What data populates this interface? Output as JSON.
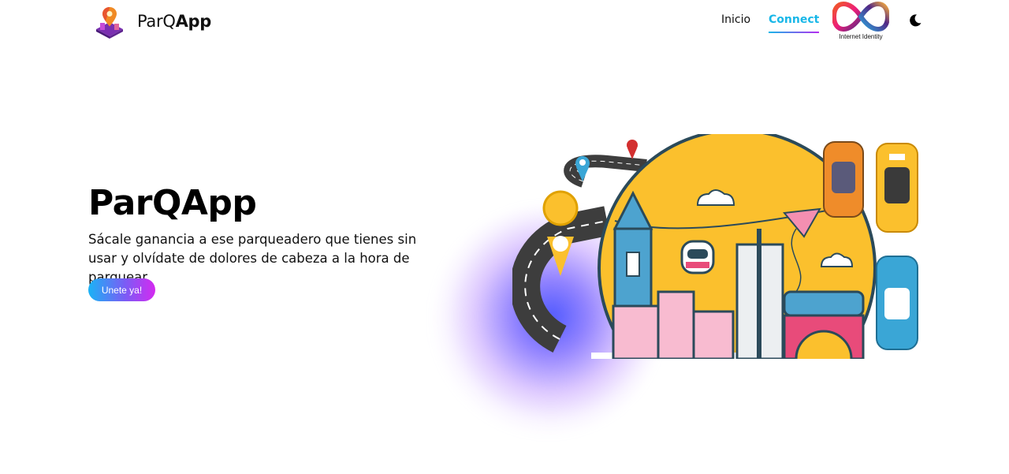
{
  "brand": {
    "name_regular": "ParQ",
    "name_bold": "App",
    "logo_icon": "parking-map-pin-logo"
  },
  "nav": {
    "links": [
      {
        "label": "Inicio",
        "active": false
      },
      {
        "label": "Connect",
        "active": true
      }
    ],
    "identity": {
      "label": "Internet Identity",
      "icon": "infinity-logo"
    },
    "theme_toggle": {
      "icon": "moon-icon"
    }
  },
  "hero": {
    "title": "ParQApp",
    "text": "Sácale ganancia a ese parqueadero que tienes sin usar y olvídate de dolores de cabeza a la hora de parquear.",
    "cta_label": "Unete ya!",
    "illustration": "city-parking-illustration"
  },
  "colors": {
    "accent": "#19b7e8",
    "cta_gradient": [
      "#1ab3f5",
      "#d42af0"
    ],
    "sun": "#fbc02d",
    "outline": "#2b4a5a"
  }
}
